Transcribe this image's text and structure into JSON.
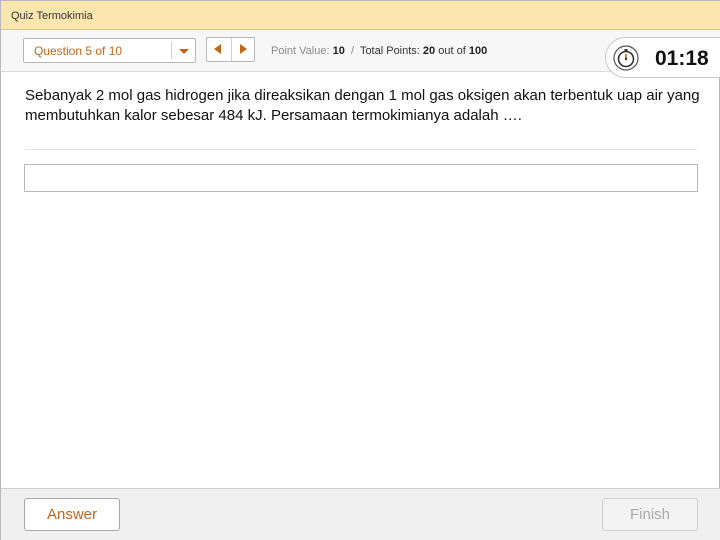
{
  "window": {
    "title": "Quiz Termokimia"
  },
  "toolbar": {
    "question_select_label": "Question 5 of 10",
    "point_value_label": "Point Value:",
    "point_value": "10",
    "separator": "/",
    "total_points_label": "Total Points:",
    "total_points": "20",
    "out_of_label": "out of",
    "max_points": "100"
  },
  "timer": {
    "value": "01:18",
    "icon": "stopwatch-icon"
  },
  "question": {
    "text": "Sebanyak 2 mol gas hidrogen jika direaksikan dengan 1 mol gas oksigen akan terbentuk uap air yang membutuhkan kalor sebesar 484 kJ. Persamaan termokimianya adalah …."
  },
  "answer_field": {
    "value": "",
    "placeholder": ""
  },
  "footer": {
    "answer_label": "Answer",
    "finish_label": "Finish"
  },
  "colors": {
    "accent": "#c0661a",
    "title_bar": "#fbe6b0",
    "disabled_text": "#a9a9a9"
  }
}
